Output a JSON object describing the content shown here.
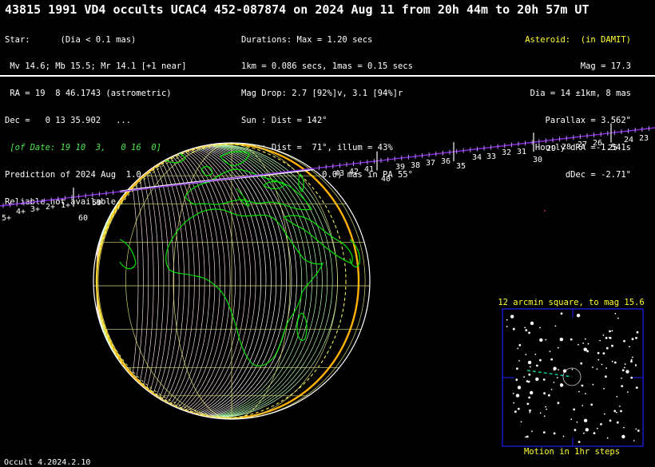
{
  "title": "43815 1991 VD4 occults UCAC4 452-087874 on 2024 Aug 11 from 20h 44m to 20h 57m UT",
  "star": {
    "line1": "Star:      (Dia < 0.1 mas)",
    "line2": " Mv 14.6; Mb 15.5; Mr 14.1 [+1 near]",
    "line3": " RA = 19  8 46.1743 (astrometric)",
    "line4": "Dec =   0 13 35.902   ...",
    "line5": " [of Date: 19 10  3,   0 16  0]",
    "line6": "Prediction of 2024 Aug  1.0",
    "line7": "Reliable not available"
  },
  "durations": {
    "line1": "Durations: Max = 1.20 secs",
    "line2": "1km = 0.086 secs, 1mas = 0.15 secs",
    "line3": "Mag Drop: 2.7 [92%]v, 3.1 [94%]r",
    "line4": "Sun : Dist = 142°",
    "line5": "Moon: Dist =  71°, illum = 43%",
    "line6": "1σ Err: ±(1.0 x 0.0) mas in PA 55°"
  },
  "asteroid": {
    "line1": "Asteroid:  (in DAMIT)",
    "line2": "Mag = 17.3",
    "line3": "Dia = 14 ±1km, 8 mas",
    "line4": "Parallax = 3.562\"",
    "line5": "Hourly dRA =-1.541s",
    "line6": "dDec = -2.71\""
  },
  "star_chart": {
    "title": "12 arcmin square, to mag 15.6",
    "caption": "Motion in 1hr steps"
  },
  "path_labels": {
    "before_earth": [
      "5+",
      "4+",
      "3+",
      "2+",
      "1+",
      "60",
      "59"
    ],
    "after_earth": [
      "43",
      "42",
      "41",
      "40",
      "39",
      "38",
      "37",
      "36",
      "35",
      "34",
      "33",
      "32",
      "31",
      "30",
      "29",
      "28",
      "27",
      "26",
      "25",
      "24",
      "23"
    ]
  },
  "footer": "Occult 4.2024.2.10",
  "colors": {
    "background": "#000000",
    "text": "#ffffff",
    "coastline": "#00e000",
    "grid": "#d8d870",
    "shadow_edge": "#ffb000",
    "path": "#8a2be2",
    "star_chart_accent": "#ffff30",
    "star_chart_frame": "#2020ff"
  }
}
